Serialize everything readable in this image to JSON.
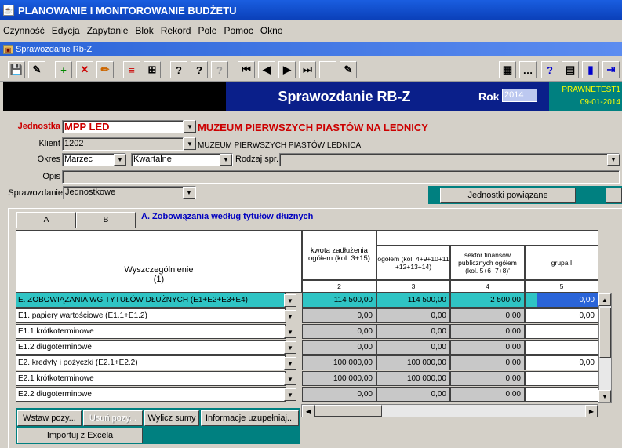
{
  "app_title": "PLANOWANIE I MONITOROWANIE BUDŻETU",
  "menu": [
    "Czynność",
    "Edycja",
    "Zapytanie",
    "Blok",
    "Rekord",
    "Pole",
    "Pomoc",
    "Okno"
  ],
  "window_title": "Sprawozdanie Rb-Z",
  "header": {
    "title": "Sprawozdanie RB-Z",
    "rok_label": "Rok",
    "rok_value": "2014",
    "user": "PRAWNETEST1",
    "date": "09-01-2014"
  },
  "form": {
    "jednostka_label": "Jednostka",
    "jednostka_value": "MPP LED",
    "jednostka_name": "MUZEUM PIERWSZYCH PIASTÓW NA LEDNICY",
    "klient_label": "Klient",
    "klient_value": "1202",
    "klient_name": "MUZEUM PIERWSZYCH PIASTÓW LEDNICA",
    "okres_label": "Okres",
    "okres_value": "Marzec",
    "okres_type": "Kwartalne",
    "rodzaj_label": "Rodzaj spr.",
    "rodzaj_value": "",
    "opis_label": "Opis",
    "opis_value": "",
    "sprawozdanie_label": "Sprawozdanie",
    "sprawozdanie_value": "Jednostkowe",
    "jednostki_button": "Jednostki powiązane"
  },
  "tabs": [
    "A",
    "B"
  ],
  "section_title": "A. Zobowiązania według tytułów dłużnych",
  "table": {
    "col1_header": "Wyszczególnienie\n(1)",
    "col2_header": "kwota zadłużenia ogółem (kol. 3+15)",
    "col3_header": "ogółem (kol. 4+9+10+11 +12+13+14)",
    "col4_header": "sektor finansów publicznych ogółem (kol. 5+6+7+8)'",
    "col5_header": "grupa I",
    "col_nums": [
      "2",
      "3",
      "4",
      "5"
    ],
    "rows": [
      {
        "label": "E. ZOBOWIĄZANIA WG TYTUŁÓW DŁUŻNYCH (E1+E2+E3+E4)",
        "c2": "114 500,00",
        "c3": "114 500,00",
        "c4": "2 500,00",
        "c5": "0,00"
      },
      {
        "label": "E1. papiery wartościowe (E1.1+E1.2)",
        "c2": "0,00",
        "c3": "0,00",
        "c4": "0,00",
        "c5": "0,00"
      },
      {
        "label": "E1.1 krótkoterminowe",
        "c2": "0,00",
        "c3": "0,00",
        "c4": "0,00",
        "c5": ""
      },
      {
        "label": "E1.2 długoterminowe",
        "c2": "0,00",
        "c3": "0,00",
        "c4": "0,00",
        "c5": ""
      },
      {
        "label": "E2. kredyty i pożyczki (E2.1+E2.2)",
        "c2": "100 000,00",
        "c3": "100 000,00",
        "c4": "0,00",
        "c5": "0,00"
      },
      {
        "label": "E2.1 krótkoterminowe",
        "c2": "100 000,00",
        "c3": "100 000,00",
        "c4": "0,00",
        "c5": ""
      },
      {
        "label": "E2.2 długoterminowe",
        "c2": "0,00",
        "c3": "0,00",
        "c4": "0,00",
        "c5": ""
      }
    ]
  },
  "buttons": {
    "wstaw": "Wstaw pozy...",
    "usun": "Usuń pozy...",
    "wylicz": "Wylicz sumy",
    "informacje": "Informacje uzupełniaj...",
    "importuj": "Importuj z Excela"
  }
}
